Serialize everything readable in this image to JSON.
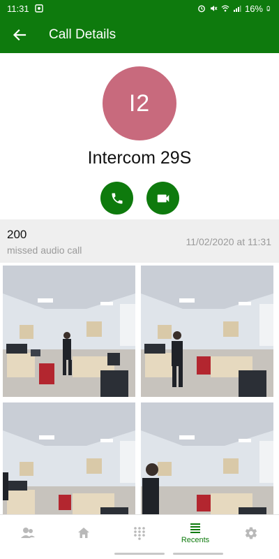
{
  "status_bar": {
    "time": "11:31",
    "battery": "16%"
  },
  "app_bar": {
    "title": "Call Details"
  },
  "contact": {
    "initials": "I2",
    "name": "Intercom 29S",
    "avatar_color": "#c86a7d"
  },
  "call_entry": {
    "number": "200",
    "type": "missed audio call",
    "timestamp": "11/02/2020 at 11:31"
  },
  "snapshots": [
    {
      "label": "snapshot-1"
    },
    {
      "label": "snapshot-2"
    },
    {
      "label": "snapshot-3"
    },
    {
      "label": "snapshot-4"
    }
  ],
  "bottom_nav": {
    "items": [
      {
        "icon": "contacts-icon",
        "label": ""
      },
      {
        "icon": "home-icon",
        "label": ""
      },
      {
        "icon": "dialpad-icon",
        "label": ""
      },
      {
        "icon": "recents-icon",
        "label": "Recents"
      },
      {
        "icon": "settings-icon",
        "label": ""
      }
    ]
  },
  "colors": {
    "primary": "#0e7a0d",
    "inactive_icon": "#b9b9b9"
  }
}
